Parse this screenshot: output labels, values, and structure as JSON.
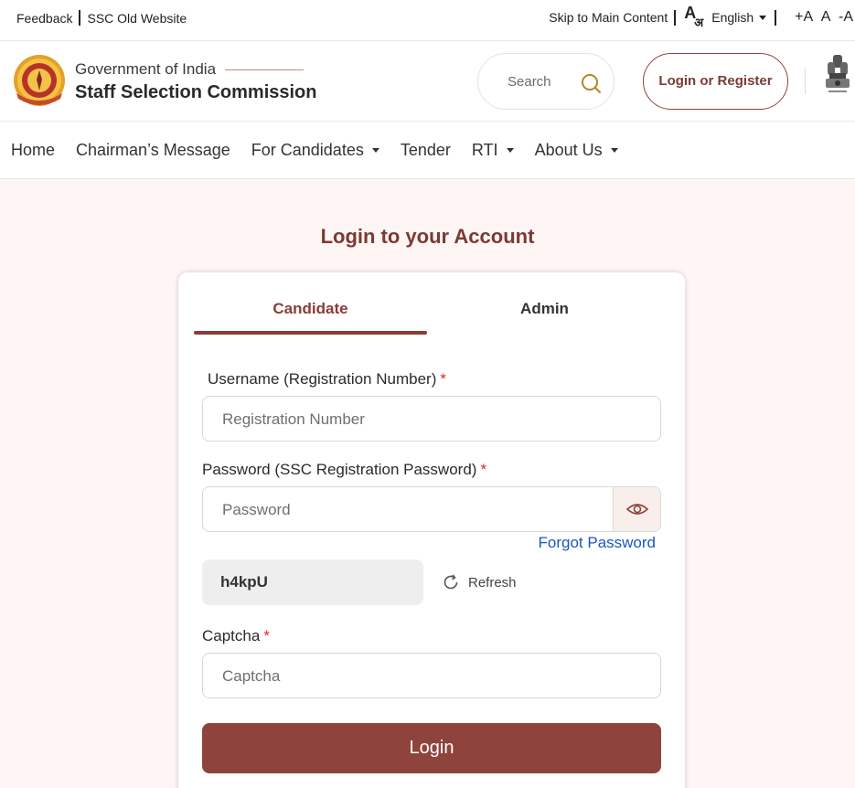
{
  "topbar": {
    "feedback": "Feedback",
    "old_website": "SSC Old Website",
    "skip": "Skip to Main Content",
    "lang_icon_big": "A",
    "lang_icon_small": "अ",
    "language": "English",
    "font_increase": "+A",
    "font_normal": "A",
    "font_decrease": "-A"
  },
  "header": {
    "gov": "Government of India",
    "org": "Staff Selection Commission",
    "search_placeholder": "Search",
    "login_button": "Login or Register"
  },
  "nav": {
    "items": [
      "Home",
      "Chairman’s Message",
      "For Candidates",
      "Tender",
      "RTI",
      "About Us"
    ]
  },
  "main": {
    "title": "Login to your Account",
    "tabs": [
      "Candidate",
      "Admin"
    ],
    "username_label": "Username (Registration Number)",
    "username_placeholder": "Registration Number",
    "password_label": "Password (SSC Registration Password)",
    "password_placeholder": "Password",
    "required_mark": "*",
    "forgot": "Forgot Password",
    "captcha_code": "h4kpU",
    "refresh": "Refresh",
    "captcha_label": "Captcha",
    "captcha_placeholder": "Captcha",
    "submit": "Login"
  },
  "colors": {
    "accent": "#8e433d",
    "link": "#1a56c4",
    "required": "#d9252a",
    "page_bg": "#fdf6f4"
  }
}
